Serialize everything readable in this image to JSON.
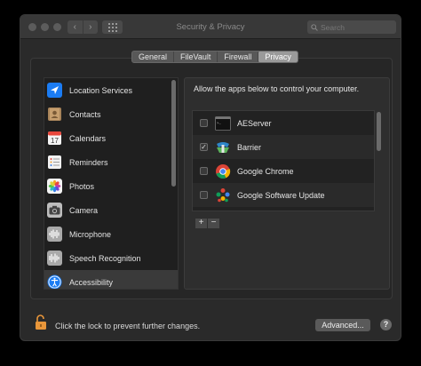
{
  "window": {
    "title": "Security & Privacy",
    "back_glyph": "‹",
    "forward_glyph": "›",
    "search_placeholder": "Search"
  },
  "tabs": [
    {
      "label": "General",
      "active": false
    },
    {
      "label": "FileVault",
      "active": false
    },
    {
      "label": "Firewall",
      "active": false
    },
    {
      "label": "Privacy",
      "active": true
    }
  ],
  "sidebar": {
    "items": [
      {
        "label": "Location Services",
        "icon": "location-arrow-icon",
        "selected": false
      },
      {
        "label": "Contacts",
        "icon": "contacts-book-icon",
        "selected": false
      },
      {
        "label": "Calendars",
        "icon": "calendar-icon",
        "selected": false
      },
      {
        "label": "Reminders",
        "icon": "reminders-list-icon",
        "selected": false
      },
      {
        "label": "Photos",
        "icon": "photos-flower-icon",
        "selected": false
      },
      {
        "label": "Camera",
        "icon": "camera-icon",
        "selected": false
      },
      {
        "label": "Microphone",
        "icon": "microphone-waveform-icon",
        "selected": false
      },
      {
        "label": "Speech Recognition",
        "icon": "speech-waveform-icon",
        "selected": false
      },
      {
        "label": "Accessibility",
        "icon": "accessibility-person-icon",
        "selected": true
      }
    ],
    "calendar_day": "17"
  },
  "main": {
    "description": "Allow the apps below to control your computer.",
    "apps": [
      {
        "label": "AEServer",
        "checked": false,
        "icon": "terminal-icon"
      },
      {
        "label": "Barrier",
        "checked": true,
        "icon": "barrier-icon"
      },
      {
        "label": "Google Chrome",
        "checked": false,
        "icon": "chrome-icon"
      },
      {
        "label": "Google Software Update",
        "checked": false,
        "icon": "google-update-icon"
      }
    ],
    "check_glyph": "✓",
    "add_label": "+",
    "remove_label": "−"
  },
  "footer": {
    "lock_text": "Click the lock to prevent further changes.",
    "advanced_label": "Advanced...",
    "help_label": "?"
  },
  "colors": {
    "accent_blue": "#1b7cf3",
    "window_bg": "#2a2a2a",
    "selected_row": "#3a3a3a",
    "lock_orange": "#e8963a"
  }
}
